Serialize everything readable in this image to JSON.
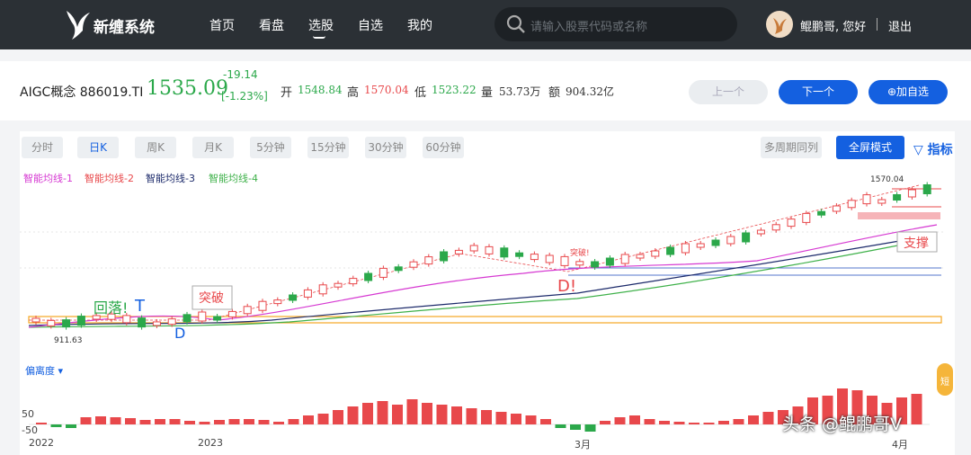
{
  "app": {
    "name": "新缠系统"
  },
  "nav": {
    "items": [
      "首页",
      "看盘",
      "选股",
      "自选",
      "我的"
    ]
  },
  "search": {
    "placeholder": "请输入股票代码或名称"
  },
  "user": {
    "greeting": "鲲鹏哥, 您好",
    "logout": "退出"
  },
  "quote": {
    "name": "AIGC概念 886019.TI",
    "price": "1535.09",
    "change": "-19.14",
    "change_pct": "[-1.23%]",
    "open_label": "开",
    "open": "1548.84",
    "high_label": "高",
    "high": "1570.04",
    "low_label": "低",
    "low": "1523.22",
    "vol_label": "量",
    "vol": "53.73万",
    "amt_label": "额",
    "amt": "904.32亿"
  },
  "buttons": {
    "prev": "上一个",
    "next": "下一个",
    "fav": "⊕加自选"
  },
  "chart_tabs": {
    "items": [
      "分时",
      "日K",
      "周K",
      "月K",
      "5分钟",
      "15分钟",
      "30分钟",
      "60分钟"
    ],
    "active": "日K",
    "multi": "多周期同列",
    "fullscreen": "全屏模式",
    "indicator": "▽ 指标"
  },
  "legend": [
    "智能均线-1",
    "智能均线-2",
    "智能均线-3",
    "智能均线-4"
  ],
  "annotations": {
    "high_value": "1570.04",
    "low_value": "911.63",
    "fall": "回落!",
    "t": "T",
    "d1": "D",
    "breakout": "突破",
    "breakout_small": "突破!",
    "d2": "D!",
    "support": "支撑"
  },
  "deviation": {
    "selector": "偏离度 ▾",
    "ticks": [
      "50",
      "-50"
    ],
    "marker": "短"
  },
  "x_labels": [
    "2022",
    "2023",
    "3月",
    "4月"
  ],
  "watermark": "头条 @鲲鹏哥V",
  "colors": {
    "up": "#e8484b",
    "down": "#2ba84a",
    "accent": "#1460e0"
  }
}
